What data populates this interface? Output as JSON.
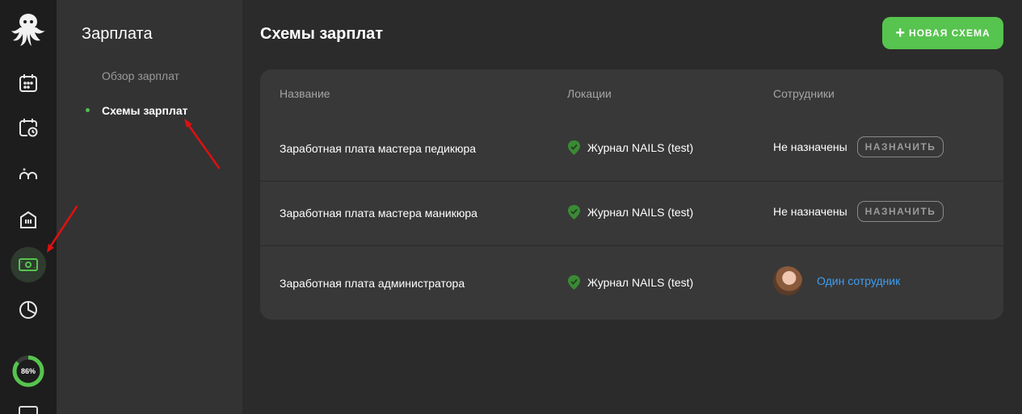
{
  "rail": {
    "items": [
      {
        "icon": "calendar-icon"
      },
      {
        "icon": "calendar-clock-icon"
      },
      {
        "icon": "clients-icon"
      },
      {
        "icon": "warehouse-icon"
      },
      {
        "icon": "money-icon",
        "active": true
      },
      {
        "icon": "pie-chart-icon"
      }
    ],
    "progress": {
      "value": 0.86,
      "label": "86%"
    }
  },
  "sidenav": {
    "title": "Зарплата",
    "items": [
      {
        "label": "Обзор зарплат",
        "active": false
      },
      {
        "label": "Схемы зарплат",
        "active": true
      }
    ]
  },
  "main": {
    "title": "Схемы зарплат",
    "new_button_label": "НОВАЯ СХЕМА",
    "table": {
      "headers": {
        "name": "Название",
        "locations": "Локации",
        "employees": "Сотрудники"
      },
      "rows": [
        {
          "name": "Заработная плата мастера педикюра",
          "location": "Журнал NAILS (test)",
          "employees": "Не назначены",
          "assign_label": "НАЗНАЧИТЬ"
        },
        {
          "name": "Заработная плата мастера маникюра",
          "location": "Журнал NAILS (test)",
          "employees": "Не назначены",
          "assign_label": "НАЗНАЧИТЬ"
        },
        {
          "name": "Заработная плата администратора",
          "location": "Журнал NAILS (test)",
          "employees": "Один сотрудник"
        }
      ]
    }
  },
  "colors": {
    "accent_green": "#56c44e",
    "link_blue": "#3f9ef2",
    "annotation_red": "#e01010"
  }
}
